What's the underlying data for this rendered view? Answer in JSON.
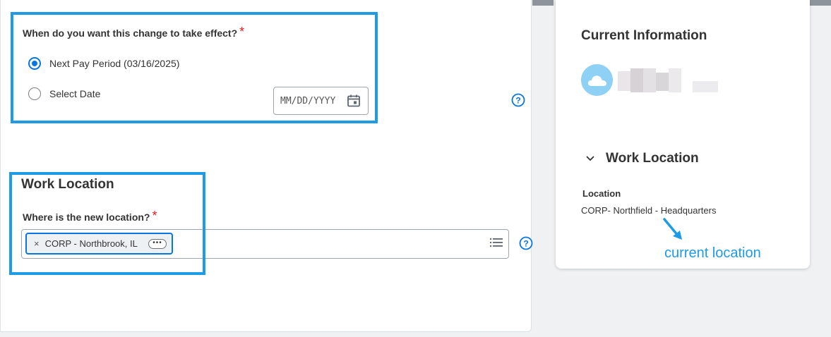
{
  "effective_date": {
    "question": "When do you want this change to take effect?",
    "required_mark": "*",
    "options": [
      {
        "label": "Next Pay Period (03/16/2025)",
        "selected": true
      },
      {
        "label": "Select Date",
        "selected": false
      }
    ],
    "date_placeholder": "MM/DD/YYYY"
  },
  "work_location": {
    "section_title": "Work Location",
    "question": "Where is the new location?",
    "required_mark": "*",
    "selected_value": "CORP - Northbrook, IL",
    "remove_glyph": "×",
    "more_glyph": "•••"
  },
  "current_info": {
    "title": "Current Information",
    "section_title": "Work Location",
    "location_label": "Location",
    "location_value": "CORP- Northfield - Headquarters"
  },
  "annotation": {
    "text": "current location",
    "color": "#1e9be7"
  },
  "colors": {
    "accent": "#0875e1",
    "required": "#de1c22",
    "annotation": "#1e9be7",
    "avatar": "#8fd0f5"
  },
  "icons": [
    "calendar-icon",
    "help-icon",
    "list-icon",
    "cloud-icon",
    "chevron-down-icon",
    "close-icon",
    "more-icon",
    "arrow-icon"
  ]
}
